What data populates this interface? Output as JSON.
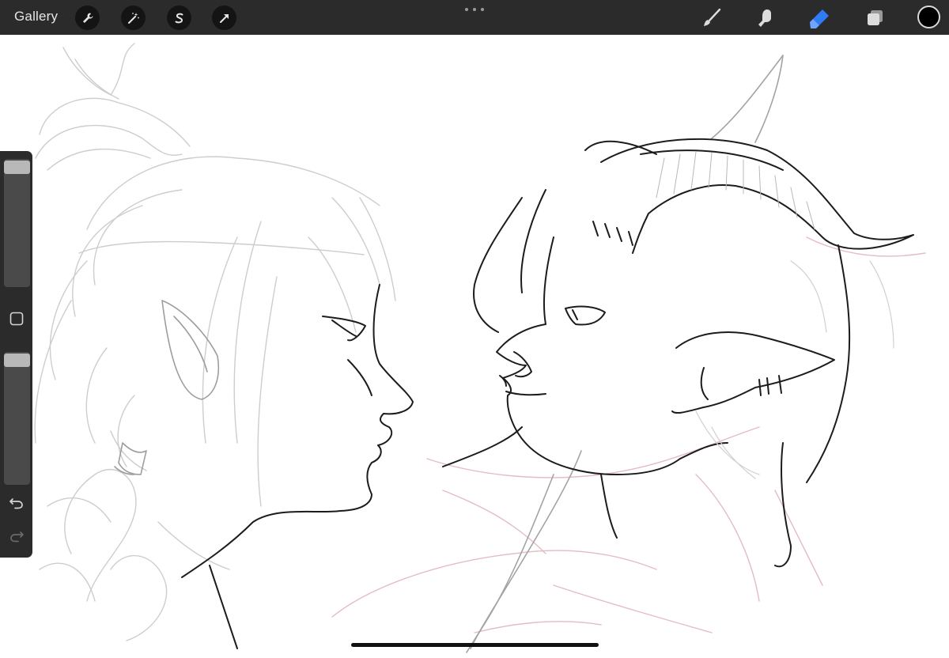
{
  "topbar": {
    "gallery_label": "Gallery",
    "left_tools": [
      "wrench-icon",
      "magic-wand-icon",
      "selection-s-icon",
      "transform-arrow-icon"
    ],
    "right_tools": [
      "brush-icon",
      "smudge-icon",
      "eraser-icon",
      "layers-icon"
    ],
    "active_tool": "eraser-icon",
    "current_color": "#000000"
  },
  "sidebar": {
    "brush_size_level": 0.0,
    "opacity_level": 0.0
  },
  "colors": {
    "toolbar_bg": "#2b2b2b",
    "active_accent": "#2f7cf6",
    "sketch_gray": "#c8c8c8",
    "sketch_red": "#e3b8bf",
    "line_black": "#1a1a1a"
  }
}
